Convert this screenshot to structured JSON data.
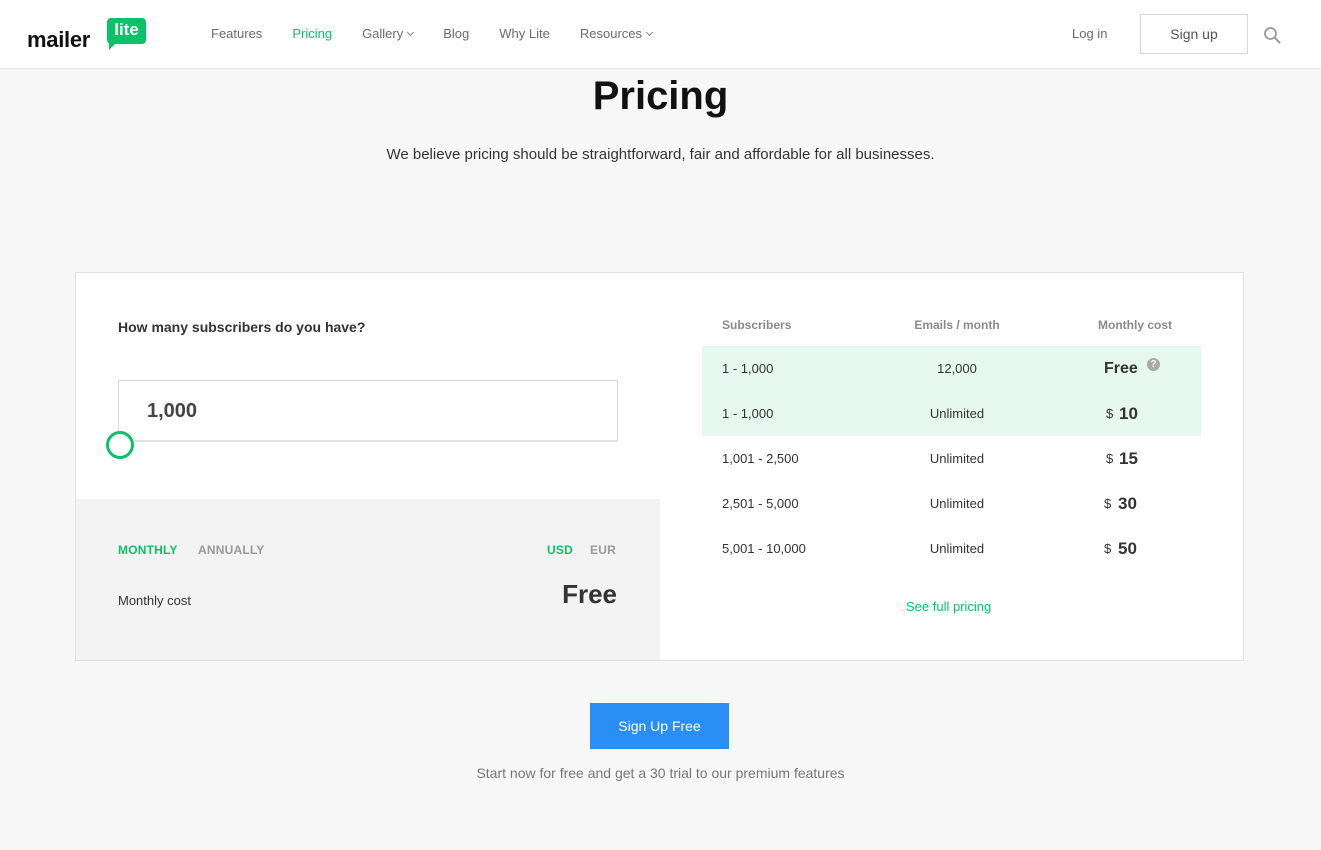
{
  "brand": {
    "word": "mailer",
    "badge": "lite",
    "accent": "#09c269",
    "cta_color": "#2a8ef7"
  },
  "nav": {
    "items": [
      {
        "label": "Features",
        "active": false,
        "dropdown": false
      },
      {
        "label": "Pricing",
        "active": true,
        "dropdown": false
      },
      {
        "label": "Gallery",
        "active": false,
        "dropdown": true
      },
      {
        "label": "Blog",
        "active": false,
        "dropdown": false
      },
      {
        "label": "Why Lite",
        "active": false,
        "dropdown": false
      },
      {
        "label": "Resources",
        "active": false,
        "dropdown": true
      }
    ],
    "login": "Log in",
    "signup": "Sign up",
    "search_icon": "search-icon"
  },
  "hero": {
    "title": "Pricing",
    "subtitle": "We believe pricing should be straightforward, fair and affordable for all businesses."
  },
  "calculator": {
    "question": "How many subscribers do you have?",
    "subscribers_value": "1,000",
    "slider_level": 0.0,
    "billing": {
      "monthly": "MONTHLY",
      "annually": "ANNUALLY",
      "selected": "MONTHLY"
    },
    "currency": {
      "usd": "USD",
      "eur": "EUR",
      "selected": "USD"
    },
    "cost_label": "Monthly cost",
    "cost_value": "Free"
  },
  "pricing_table": {
    "headers": [
      "Subscribers",
      "Emails / month",
      "Monthly cost"
    ],
    "rows": [
      {
        "subscribers": "1 - 1,000",
        "emails": "12,000",
        "cost": "Free",
        "highlighted": true
      },
      {
        "subscribers": "1 - 1,000",
        "emails": "Unlimited",
        "currency": "$",
        "cost": "10",
        "highlighted": true
      },
      {
        "subscribers": "1,001 - 2,500",
        "emails": "Unlimited",
        "currency": "$",
        "cost": "15",
        "highlighted": false
      },
      {
        "subscribers": "2,501 - 5,000",
        "emails": "Unlimited",
        "currency": "$",
        "cost": "30",
        "highlighted": false
      },
      {
        "subscribers": "5,001 - 10,000",
        "emails": "Unlimited",
        "currency": "$",
        "cost": "50",
        "highlighted": false
      }
    ],
    "help_glyph": "?",
    "see_full": "See full pricing"
  },
  "cta": {
    "button": "Sign Up Free",
    "note": "Start now for free and get a 30 trial to our premium features"
  }
}
